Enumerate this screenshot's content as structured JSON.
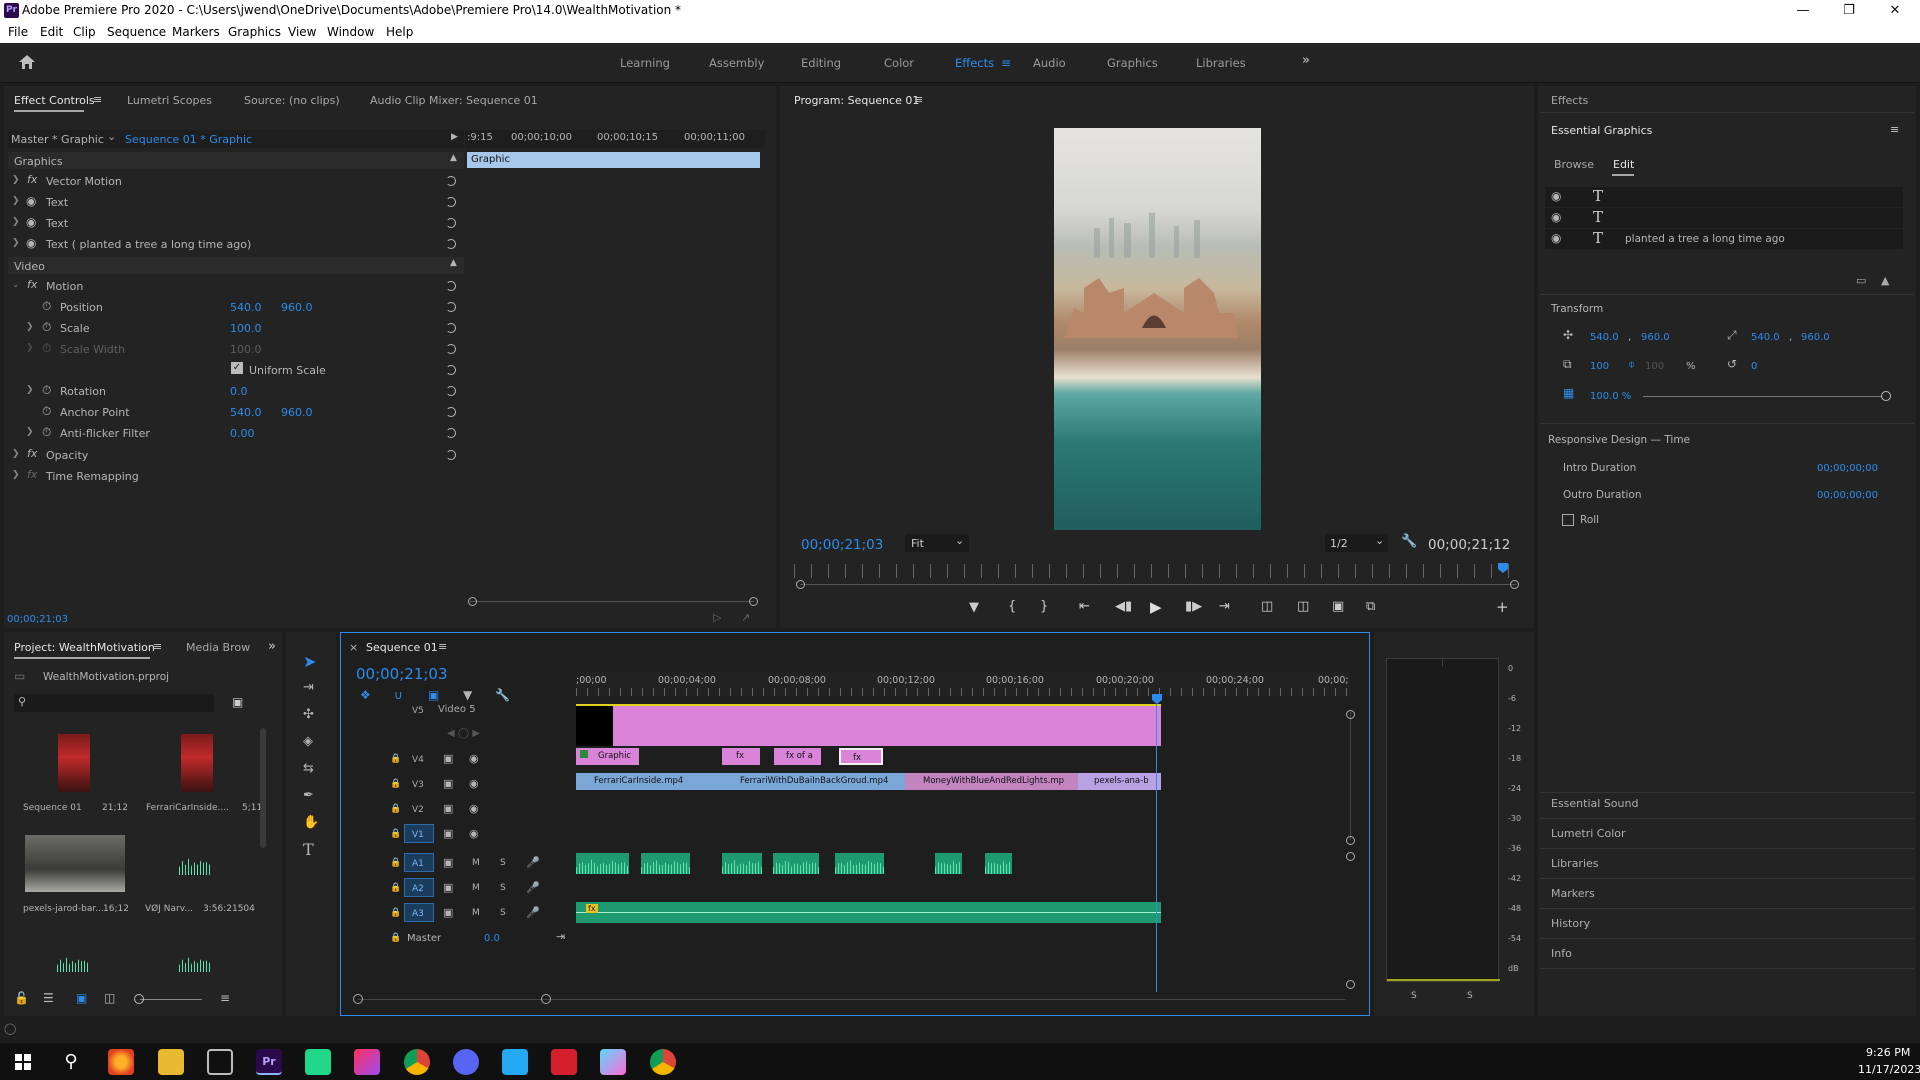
{
  "window": {
    "title": "Adobe Premiere Pro 2020 - C:\\Users\\jwend\\OneDrive\\Documents\\Adobe\\Premiere Pro\\14.0\\WealthMotivation *",
    "app_icon": "Pr"
  },
  "menu": [
    "File",
    "Edit",
    "Clip",
    "Sequence",
    "Markers",
    "Graphics",
    "View",
    "Window",
    "Help"
  ],
  "workspaces": [
    "Learning",
    "Assembly",
    "Editing",
    "Color",
    "Effects",
    "Audio",
    "Graphics",
    "Libraries"
  ],
  "workspace_active": "Effects",
  "effect_controls": {
    "tabs": [
      "Effect Controls",
      "Lumetri Scopes",
      "Source: (no clips)",
      "Audio Clip Mixer: Sequence 01"
    ],
    "master": "Master * Graphic",
    "sequence": "Sequence 01 * Graphic",
    "ruler": [
      ":9:15",
      "00;00;10;00",
      "00;00;10;15",
      "00;00;11;00"
    ],
    "clip_bar": "Graphic",
    "section_graphics": "Graphics",
    "graphics_rows": [
      "Vector Motion",
      "Text",
      "Text",
      "Text ( planted a tree a    long time ago)"
    ],
    "section_video": "Video",
    "motion": "Motion",
    "props": [
      {
        "label": "Position",
        "v1": "540.0",
        "v2": "960.0"
      },
      {
        "label": "Scale",
        "v1": "100.0",
        "v2": ""
      },
      {
        "label": "Scale Width",
        "v1": "100.0",
        "v2": ""
      },
      {
        "label": "Uniform Scale",
        "v1": "",
        "v2": ""
      },
      {
        "label": "Rotation",
        "v1": "0.0",
        "v2": ""
      },
      {
        "label": "Anchor Point",
        "v1": "540.0",
        "v2": "960.0"
      },
      {
        "label": "Anti-flicker Filter",
        "v1": "0.00",
        "v2": ""
      }
    ],
    "opacity": "Opacity",
    "time_remap": "Time Remapping",
    "timecode": "00;00;21;03"
  },
  "program": {
    "title": "Program: Sequence 01",
    "timecode_left": "00;00;21;03",
    "fit": "Fit",
    "resolution": "1/2",
    "timecode_right": "00;00;21;12"
  },
  "effects_panel": {
    "title": "Effects",
    "eg_title": "Essential Graphics",
    "tabs": [
      "Browse",
      "Edit"
    ],
    "layers": [
      "",
      "",
      "planted a tree a    long time ago"
    ],
    "transform_label": "Transform",
    "pos": [
      "540.0",
      ",",
      "960.0"
    ],
    "anchor": [
      "540.0",
      ",",
      "960.0"
    ],
    "scale": "100",
    "scale2": "100",
    "percent": "%",
    "rotation": "0",
    "opacity": "100.0 %",
    "responsive": "Responsive Design — Time",
    "intro_label": "Intro Duration",
    "intro_val": "00;00;00;00",
    "outro_label": "Outro Duration",
    "outro_val": "00;00;00;00",
    "roll": "Roll",
    "lower": [
      "Essential Sound",
      "Lumetri Color",
      "Libraries",
      "Markers",
      "History",
      "Info"
    ]
  },
  "project": {
    "tabs": [
      "Project: WealthMotivation",
      "Media Brow"
    ],
    "file": "WealthMotivation.prproj",
    "items": [
      {
        "name": "Sequence 01",
        "dur": "21;12"
      },
      {
        "name": "FerrariCarInside....",
        "dur": "5;11"
      },
      {
        "name": "pexels-jarod-bar...",
        "dur": "16;12"
      },
      {
        "name": "VØJ Narv...",
        "dur": "3:56:21504"
      }
    ]
  },
  "timeline": {
    "title": "Sequence 01",
    "timecode": "00;00;21;03",
    "ruler": [
      ";00;00",
      "00;00;04;00",
      "00;00;08;00",
      "00;00;12;00",
      "00;00;16;00",
      "00;00;20;00",
      "00;00;24;00",
      "00;00;"
    ],
    "video_tracks": [
      "V5",
      "V4",
      "V3",
      "V2",
      "V1"
    ],
    "v5_name": "Video 5",
    "audio_tracks": [
      "A1",
      "A2",
      "A3"
    ],
    "master": "Master",
    "master_val": "0.0",
    "clips": {
      "graphic": "Graphic",
      "fx1": "fx",
      "fx2": "fx  of a",
      "fx3": "fx",
      "c1": "FerrariCarInside.mp4",
      "c2": "FerrariWithDuBaiInBackGroud.mp4",
      "c3": "MoneyWithBlueAndRedLights.mp",
      "c4": "pexels-ana-b"
    },
    "audio_fx": "fx"
  },
  "meter": {
    "labels": [
      "0",
      "-6",
      "-12",
      "-18",
      "-24",
      "-30",
      "-36",
      "-42",
      "-48",
      "-54",
      "dB"
    ],
    "solo": [
      "S",
      "S"
    ]
  },
  "taskbar": {
    "time": "9:26 PM",
    "date": "11/17/2023"
  }
}
